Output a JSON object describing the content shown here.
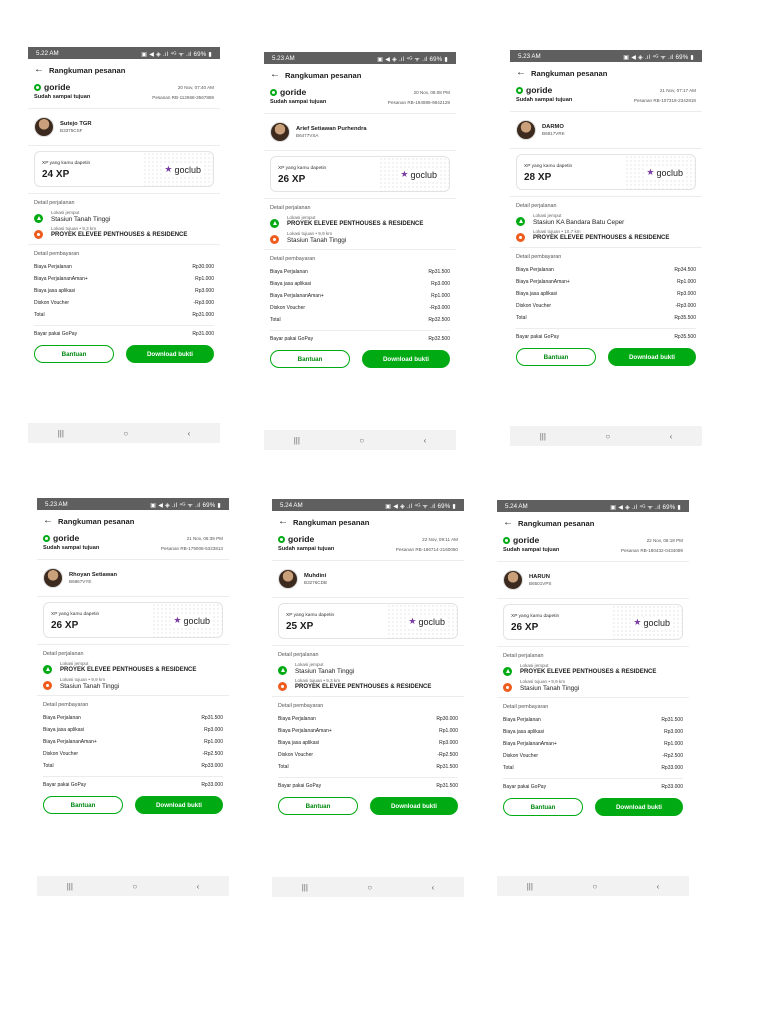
{
  "common": {
    "header_title": "Rangkuman pesanan",
    "brand": "goride",
    "status_done": "Sudah sampai tujuan",
    "xp_label": "XP yang kamu dapetin",
    "goclub": "goclub",
    "trip_title": "Detail perjalanan",
    "pickup_label": "Lokasi jemput",
    "payment_title": "Detail pembayaran",
    "btn_help": "Bantuan",
    "btn_download": "Download bukti",
    "status_icons": "▣ ◀ ◈ .ıl ⁴ᴳ ᯤ .ıl 69% ▮",
    "nav_recent": "|||",
    "nav_home": "○",
    "nav_back": "‹",
    "colors": {
      "green": "#00aa13",
      "orange": "#ee5c1e",
      "goclub_purple": "#7b3fa3"
    }
  },
  "screens": [
    {
      "time": "5.22 AM",
      "date": "20 Nov, 07:40 AM",
      "order": "Pesanan RB-112668-3567869",
      "driver": "Sutejo TGR",
      "plate": "B3375CSF",
      "xp": "24 XP",
      "pickup": "Stasiun Tanah Tinggi",
      "pickup_bold": false,
      "dest_label": "Lokasi tujuan • 9,3 km",
      "dest": "PROYEK ELEVEE PENTHOUSES & RESIDENCE",
      "dest_bold": true,
      "rows": [
        {
          "label": "Biaya Perjalanan",
          "value": "Rp30.000"
        },
        {
          "label": "Biaya PerjalananAman+",
          "value": "Rp1.000"
        },
        {
          "label": "Biaya jasa aplikasi",
          "value": "Rp3.000"
        },
        {
          "label": "Diskon Voucher",
          "value": "-Rp3.000"
        },
        {
          "label": "Total",
          "value": "Rp31.000"
        }
      ],
      "pay_label": "Bayar pakai GoPay",
      "pay_value": "Rp31.000"
    },
    {
      "time": "5.23 AM",
      "date": "20 Nov, 06:08 PM",
      "order": "Pesanan RB-194986-9842129",
      "driver": "Arief Setiawan Purhendra",
      "plate": "B6477VSA",
      "xp": "26 XP",
      "pickup": "PROYEK ELEVEE PENTHOUSES & RESIDENCE",
      "pickup_bold": true,
      "dest_label": "Lokasi tujuan • 9,9 km",
      "dest": "Stasiun Tanah Tinggi",
      "dest_bold": false,
      "rows": [
        {
          "label": "Biaya Perjalanan",
          "value": "Rp31.500"
        },
        {
          "label": "Biaya jasa aplikasi",
          "value": "Rp3.000"
        },
        {
          "label": "Biaya PerjalananAman+",
          "value": "Rp1.000"
        },
        {
          "label": "Diskon Voucher",
          "value": "-Rp3.000"
        },
        {
          "label": "Total",
          "value": "Rp32.500"
        }
      ],
      "pay_label": "Bayar pakai GoPay",
      "pay_value": "Rp32.500"
    },
    {
      "time": "5.23 AM",
      "date": "21 Nov, 07:17 AM",
      "order": "Pesanan RB-107318-2342818",
      "driver": "DARMO",
      "plate": "B6917VRK",
      "xp": "28 XP",
      "pickup": "Stasiun KA Bandara Batu Ceper",
      "pickup_bold": false,
      "dest_label": "Lokasi tujuan • 10,7 km",
      "dest": "PROYEK ELEVEE PENTHOUSES & RESIDENCE",
      "dest_bold": true,
      "rows": [
        {
          "label": "Biaya Perjalanan",
          "value": "Rp34.500"
        },
        {
          "label": "Biaya PerjalananAman+",
          "value": "Rp1.000"
        },
        {
          "label": "Biaya jasa aplikasi",
          "value": "Rp3.000"
        },
        {
          "label": "Diskon Voucher",
          "value": "-Rp3.000"
        },
        {
          "label": "Total",
          "value": "Rp35.500"
        }
      ],
      "pay_label": "Bayar pakai GoPay",
      "pay_value": "Rp35.500"
    },
    {
      "time": "5.23 AM",
      "date": "21 Nov, 06:39 PM",
      "order": "Pesanan RB-179008-5323813",
      "driver": "Rhoyan Setiawan",
      "plate": "B6867VYE",
      "xp": "26 XP",
      "pickup": "PROYEK ELEVEE PENTHOUSES & RESIDENCE",
      "pickup_bold": true,
      "dest_label": "Lokasi tujuan • 9,9 km",
      "dest": "Stasiun Tanah Tinggi",
      "dest_bold": false,
      "rows": [
        {
          "label": "Biaya Perjalanan",
          "value": "Rp31.500"
        },
        {
          "label": "Biaya jasa aplikasi",
          "value": "Rp3.000"
        },
        {
          "label": "Biaya PerjalananAman+",
          "value": "Rp1.000"
        },
        {
          "label": "Diskon Voucher",
          "value": "-Rp2.500"
        },
        {
          "label": "Total",
          "value": "Rp33.000"
        }
      ],
      "pay_label": "Bayar pakai GoPay",
      "pay_value": "Rp33.000"
    },
    {
      "time": "5.24 AM",
      "date": "22 Nov, 09:11 AM",
      "order": "Pesanan RB-186714-2160050",
      "driver": "Muhdini",
      "plate": "B3276CDB",
      "xp": "25 XP",
      "pickup": "Stasiun Tanah Tinggi",
      "pickup_bold": false,
      "dest_label": "Lokasi tujuan • 9,3 km",
      "dest": "PROYEK ELEVEE PENTHOUSES & RESIDENCE",
      "dest_bold": true,
      "rows": [
        {
          "label": "Biaya Perjalanan",
          "value": "Rp30.000"
        },
        {
          "label": "Biaya PerjalananAman+",
          "value": "Rp1.000"
        },
        {
          "label": "Biaya jasa aplikasi",
          "value": "Rp3.000"
        },
        {
          "label": "Diskon Voucher",
          "value": "-Rp2.500"
        },
        {
          "label": "Total",
          "value": "Rp31.500"
        }
      ],
      "pay_label": "Bayar pakai GoPay",
      "pay_value": "Rp31.500"
    },
    {
      "time": "5.24 AM",
      "date": "22 Nov, 06:18 PM",
      "order": "Pesanan RB-180432-0434089",
      "driver": "HARUN",
      "plate": "B6501VPS",
      "xp": "26 XP",
      "pickup": "PROYEK ELEVEE PENTHOUSES & RESIDENCE",
      "pickup_bold": true,
      "dest_label": "Lokasi tujuan • 9,9 km",
      "dest": "Stasiun Tanah Tinggi",
      "dest_bold": false,
      "rows": [
        {
          "label": "Biaya Perjalanan",
          "value": "Rp31.500"
        },
        {
          "label": "Biaya jasa aplikasi",
          "value": "Rp3.000"
        },
        {
          "label": "Biaya PerjalananAman+",
          "value": "Rp1.000"
        },
        {
          "label": "Diskon Voucher",
          "value": "-Rp2.500"
        },
        {
          "label": "Total",
          "value": "Rp33.000"
        }
      ],
      "pay_label": "Bayar pakai GoPay",
      "pay_value": "Rp33.000"
    }
  ]
}
